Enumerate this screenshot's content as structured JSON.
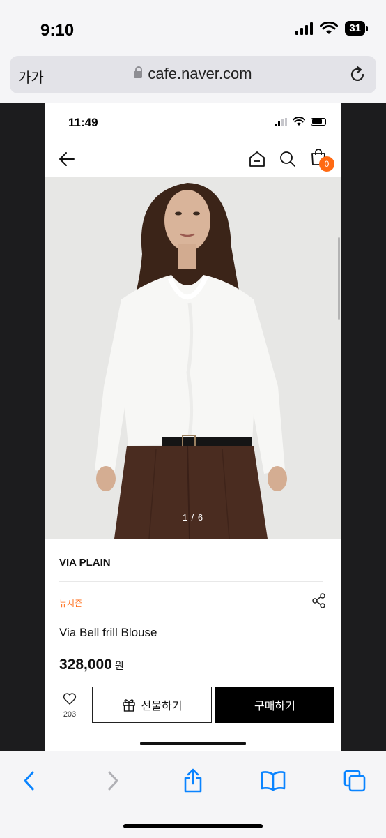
{
  "os_status": {
    "time": "9:10",
    "battery": "31"
  },
  "browser": {
    "text_size_label": "가가",
    "host": "cafe.naver.com"
  },
  "inner_status": {
    "time": "11:49"
  },
  "cart": {
    "count": "0"
  },
  "gallery": {
    "pager": "1 / 6"
  },
  "product": {
    "brand": "VIA PLAIN",
    "tag": "뉴시즌",
    "name": "Via Bell frill Blouse",
    "price": "328,000",
    "currency": "원"
  },
  "actions": {
    "like_count": "203",
    "gift_label": "선물하기",
    "buy_label": "구매하기"
  },
  "colors": {
    "accent": "#ff6a13",
    "safari_blue": "#0a84ff"
  }
}
